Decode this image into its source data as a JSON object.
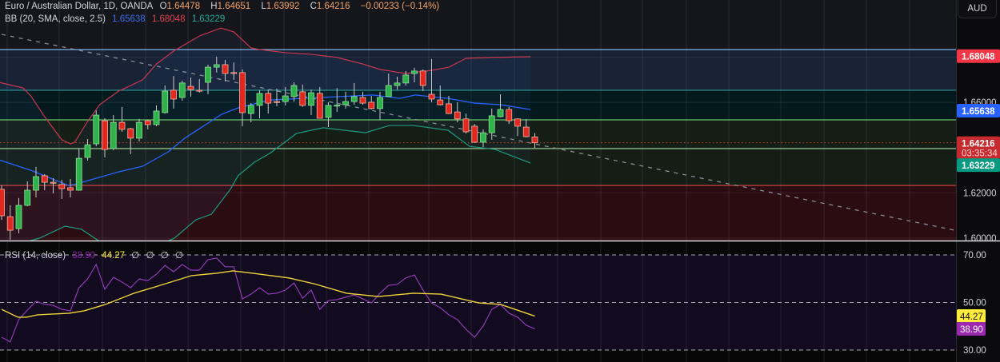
{
  "header": {
    "symbol": "Euro / Australian Dollar, 1D, OANDA",
    "o_label": "O",
    "o": "1.64478",
    "h_label": "H",
    "h": "1.64651",
    "l_label": "L",
    "l": "1.63992",
    "c_label": "C",
    "c": "1.64216",
    "change": "−0.00233 (−0.14%)"
  },
  "bb_legend": {
    "label": "BB (20, SMA, close, 2.5)",
    "basis": "1.65638",
    "upper": "1.68048",
    "lower": "1.63229"
  },
  "rsi_legend": {
    "label": "RSI (14, close)",
    "rsi": "38.90",
    "ma": "44.27",
    "extra": [
      "∅",
      "∅",
      "∅",
      "∅"
    ]
  },
  "currency_button": "AUD",
  "colors": {
    "up": "#30b24a",
    "down": "#e0281e",
    "bb_upper": "#c8374e",
    "bb_basis": "#2962ff",
    "bb_lower": "#1e9a80",
    "rsi": "#9b3fc0",
    "rsi_ma": "#f0d43a"
  },
  "chart_data": [
    {
      "type": "candlestick",
      "title": "Euro / Australian Dollar, 1D, OANDA",
      "ylim": [
        1.599,
        1.6935
      ],
      "candles": [
        [
          1.6216,
          1.6233,
          1.6081,
          1.6099
        ],
        [
          1.6095,
          1.6145,
          1.5993,
          1.6035
        ],
        [
          1.6042,
          1.6177,
          1.6021,
          1.6145
        ],
        [
          1.6145,
          1.6251,
          1.6141,
          1.6212
        ],
        [
          1.6212,
          1.6315,
          1.618,
          1.6272
        ],
        [
          1.6276,
          1.6283,
          1.6212,
          1.6247
        ],
        [
          1.6247,
          1.6265,
          1.6198,
          1.6245
        ],
        [
          1.6237,
          1.6258,
          1.6173,
          1.6219
        ],
        [
          1.6223,
          1.6262,
          1.618,
          1.6212
        ],
        [
          1.6212,
          1.6396,
          1.6209,
          1.6353
        ],
        [
          1.6357,
          1.6438,
          1.6343,
          1.6413
        ],
        [
          1.6417,
          1.6565,
          1.6406,
          1.6544
        ],
        [
          1.6519,
          1.653,
          1.6357,
          1.6392
        ],
        [
          1.6396,
          1.6544,
          1.6389,
          1.6512
        ],
        [
          1.6512,
          1.658,
          1.647,
          1.6481
        ],
        [
          1.6484,
          1.6488,
          1.6371,
          1.6442
        ],
        [
          1.6442,
          1.6527,
          1.6428,
          1.6512
        ],
        [
          1.6519,
          1.6523,
          1.6481,
          1.6502
        ],
        [
          1.6502,
          1.6587,
          1.6495,
          1.6562
        ],
        [
          1.6555,
          1.6675,
          1.6551,
          1.665
        ],
        [
          1.6654,
          1.6717,
          1.6573,
          1.6615
        ],
        [
          1.6622,
          1.6696,
          1.6608,
          1.6686
        ],
        [
          1.6671,
          1.671,
          1.6626,
          1.6657
        ],
        [
          1.6654,
          1.6703,
          1.6643,
          1.6652
        ],
        [
          1.6689,
          1.6767,
          1.6636,
          1.6756
        ],
        [
          1.6756,
          1.6802,
          1.6732,
          1.6767
        ],
        [
          1.6767,
          1.6788,
          1.6693,
          1.6728
        ],
        [
          1.6732,
          1.6777,
          1.67,
          1.6731
        ],
        [
          1.6732,
          1.6746,
          1.6495,
          1.6555
        ],
        [
          1.6551,
          1.6597,
          1.6512,
          1.6587
        ],
        [
          1.6587,
          1.6654,
          1.653,
          1.664
        ],
        [
          1.664,
          1.6657,
          1.6551,
          1.6597
        ],
        [
          1.6604,
          1.6661,
          1.6583,
          1.6603
        ],
        [
          1.6604,
          1.6668,
          1.6587,
          1.6629
        ],
        [
          1.6626,
          1.6689,
          1.6604,
          1.6675
        ],
        [
          1.6647,
          1.6679,
          1.658,
          1.6587
        ],
        [
          1.6587,
          1.6657,
          1.6544,
          1.6643
        ],
        [
          1.664,
          1.6668,
          1.653,
          1.653
        ],
        [
          1.6534,
          1.6601,
          1.6491,
          1.6587
        ],
        [
          1.6587,
          1.6664,
          1.6558,
          1.6588
        ],
        [
          1.659,
          1.6647,
          1.6573,
          1.6604
        ],
        [
          1.6604,
          1.6686,
          1.659,
          1.6626
        ],
        [
          1.6622,
          1.6647,
          1.659,
          1.6597
        ],
        [
          1.6601,
          1.6629,
          1.6569,
          1.6573
        ],
        [
          1.6573,
          1.6647,
          1.6523,
          1.6622
        ],
        [
          1.6626,
          1.6728,
          1.6626,
          1.6675
        ],
        [
          1.6675,
          1.6714,
          1.6657,
          1.6686
        ],
        [
          1.6686,
          1.6739,
          1.6675,
          1.6721
        ],
        [
          1.6728,
          1.6753,
          1.6689,
          1.6739
        ],
        [
          1.6739,
          1.6746,
          1.665,
          1.6675
        ],
        [
          1.6636,
          1.6792,
          1.6601,
          1.6615
        ],
        [
          1.6611,
          1.6675,
          1.6587,
          1.659
        ],
        [
          1.6594,
          1.6629,
          1.6548,
          1.6551
        ],
        [
          1.6558,
          1.6601,
          1.6512,
          1.6527
        ],
        [
          1.6527,
          1.6551,
          1.6463,
          1.647
        ],
        [
          1.6495,
          1.6505,
          1.6421,
          1.6424
        ],
        [
          1.6424,
          1.6481,
          1.6403,
          1.6466
        ],
        [
          1.6466,
          1.6573,
          1.6435,
          1.6541
        ],
        [
          1.6537,
          1.6636,
          1.6534,
          1.6569
        ],
        [
          1.6569,
          1.658,
          1.6505,
          1.6519
        ],
        [
          1.6527,
          1.653,
          1.6452,
          1.6495
        ],
        [
          1.6491,
          1.6527,
          1.6445,
          1.6449
        ],
        [
          1.64478,
          1.64651,
          1.63992,
          1.64216
        ]
      ],
      "bb_upper": [
        [
          0.7,
          1.6689
        ],
        [
          3.5,
          1.6664
        ],
        [
          4.4,
          1.6629
        ],
        [
          6,
          1.6537
        ],
        [
          8,
          1.6435
        ],
        [
          9,
          1.6417
        ],
        [
          9.5,
          1.6424
        ],
        [
          11,
          1.6516
        ],
        [
          12.4,
          1.659
        ],
        [
          14.6,
          1.665
        ],
        [
          17.4,
          1.67
        ],
        [
          19,
          1.677
        ],
        [
          21,
          1.6827
        ],
        [
          24,
          1.6894
        ],
        [
          26.5,
          1.6929
        ],
        [
          28,
          1.6912
        ],
        [
          30,
          1.6841
        ],
        [
          31,
          1.6834
        ],
        [
          34,
          1.682
        ],
        [
          37,
          1.6813
        ],
        [
          40,
          1.6799
        ],
        [
          43,
          1.677
        ],
        [
          45,
          1.6746
        ],
        [
          48,
          1.6728
        ],
        [
          51,
          1.6742
        ],
        [
          53,
          1.6756
        ],
        [
          55,
          1.6795
        ],
        [
          58,
          1.6799
        ],
        [
          62.5,
          1.6802
        ]
      ],
      "bb_basis": [
        [
          0.7,
          1.6346
        ],
        [
          4.4,
          1.63
        ],
        [
          8.8,
          1.6233
        ],
        [
          9.7,
          1.624
        ],
        [
          14.6,
          1.6293
        ],
        [
          17.4,
          1.6318
        ],
        [
          20.4,
          1.6382
        ],
        [
          22.3,
          1.6442
        ],
        [
          26.6,
          1.6548
        ],
        [
          28.5,
          1.6576
        ],
        [
          32.2,
          1.6611
        ],
        [
          44.2,
          1.6633
        ],
        [
          47.3,
          1.6618
        ],
        [
          49.1,
          1.6633
        ],
        [
          52.9,
          1.6618
        ],
        [
          56,
          1.6597
        ],
        [
          59,
          1.659
        ],
        [
          62.5,
          1.6569
        ]
      ],
      "bb_lower": [
        [
          0.7,
          1.595
        ],
        [
          5.4,
          1.6
        ],
        [
          8.4,
          1.6053
        ],
        [
          10.3,
          1.6039
        ],
        [
          11.8,
          1.6
        ],
        [
          14,
          1.595
        ],
        [
          18,
          1.595
        ],
        [
          21.1,
          1.6
        ],
        [
          23.6,
          1.6081
        ],
        [
          25.4,
          1.6106
        ],
        [
          27.6,
          1.6216
        ],
        [
          28.5,
          1.6276
        ],
        [
          30.4,
          1.6336
        ],
        [
          32.2,
          1.6375
        ],
        [
          35.3,
          1.6463
        ],
        [
          38.4,
          1.6488
        ],
        [
          43.3,
          1.6466
        ],
        [
          46.1,
          1.6498
        ],
        [
          48.9,
          1.6498
        ],
        [
          52.9,
          1.6477
        ],
        [
          55.4,
          1.6406
        ],
        [
          58.4,
          1.6392
        ],
        [
          62.5,
          1.6332
        ]
      ],
      "levels": [
        {
          "value": 1.6834,
          "color": "#7fb2e0"
        },
        {
          "value": 1.6654,
          "color": "#2a9c94"
        },
        {
          "value": 1.6523,
          "color": "#6cbf6c"
        },
        {
          "value": 1.6396,
          "color": "#9fd49a"
        },
        {
          "value": 1.6233,
          "color": "#d9454e"
        }
      ],
      "zones": [
        {
          "from": 1.6834,
          "to": 1.6654,
          "color": "#172335"
        },
        {
          "from": 1.6654,
          "to": 1.6523,
          "color": "#04191c"
        },
        {
          "from": 1.6523,
          "to": 1.6233,
          "color": "#141e15"
        },
        {
          "from": 1.6233,
          "to": 1.59,
          "color": "#2a0c11"
        }
      ],
      "trendline": [
        [
          1,
          1.6901
        ],
        [
          116.3,
          1.6
        ]
      ],
      "current_price": 1.64216,
      "price_axis": {
        "ticks": [
          {
            "value": 1.66,
            "text": "1.66000"
          },
          {
            "value": 1.62,
            "text": "1.62000"
          },
          {
            "value": 1.6,
            "text": "1.60000"
          }
        ],
        "badges": [
          {
            "value": 1.68048,
            "text": "1.68048",
            "color": "#f23645"
          },
          {
            "value": 1.65638,
            "text": "1.65638",
            "color": "#2962ff"
          },
          {
            "value": 1.64216,
            "text": "1.64216",
            "color": "#c62a2f"
          },
          {
            "value": 1.63229,
            "text": "1.63229",
            "color": "#089981"
          }
        ],
        "countdown": "03:35:34"
      }
    },
    {
      "type": "line",
      "title": "RSI (14, close)",
      "ylim": [
        25,
        75
      ],
      "bands": [
        70,
        50,
        30
      ],
      "rsi": [
        35.4,
        33.4,
        42.8,
        46.8,
        50.5,
        49.2,
        48.8,
        47.1,
        46.5,
        56.2,
        59.9,
        66.0,
        55.5,
        60.6,
        58.6,
        56.2,
        59.9,
        59.2,
        61.9,
        65.6,
        62.9,
        66.0,
        63.6,
        63.6,
        68.0,
        68.7,
        65.0,
        65.0,
        51.5,
        53.5,
        56.2,
        53.5,
        53.9,
        55.2,
        58.2,
        51.8,
        55.2,
        47.1,
        50.8,
        51.2,
        52.2,
        53.2,
        51.5,
        49.8,
        53.9,
        57.2,
        57.6,
        60.3,
        61.6,
        55.2,
        49.8,
        47.8,
        44.8,
        42.8,
        38.7,
        35.4,
        40.1,
        47.1,
        49.2,
        45.5,
        43.8,
        40.4,
        38.9
      ],
      "rsi_ma": [
        [
          1,
          47.1
        ],
        [
          2.9,
          43.8
        ],
        [
          3.9,
          43.8
        ],
        [
          5.2,
          44.8
        ],
        [
          8.9,
          45.5
        ],
        [
          10.6,
          46.5
        ],
        [
          13.1,
          49.2
        ],
        [
          16.4,
          53.9
        ],
        [
          18.9,
          56.6
        ],
        [
          23.1,
          61.3
        ],
        [
          26,
          62.3
        ],
        [
          27.9,
          63.3
        ],
        [
          30.2,
          62.3
        ],
        [
          34.4,
          60.3
        ],
        [
          37.3,
          57.9
        ],
        [
          41.1,
          53.9
        ],
        [
          44.8,
          52.5
        ],
        [
          48.9,
          53.9
        ],
        [
          52.1,
          53.5
        ],
        [
          56.5,
          49.8
        ],
        [
          59,
          49.2
        ],
        [
          63,
          44.27
        ]
      ],
      "axis": {
        "ticks": [
          {
            "value": 70,
            "text": "70.00"
          },
          {
            "value": 50,
            "text": "50.00"
          },
          {
            "value": 30,
            "text": "30.00"
          }
        ],
        "badges": [
          {
            "value": 44.27,
            "text": "44.27",
            "color": "#ffeb3b",
            "textColor": "#111111"
          },
          {
            "value": 38.9,
            "text": "38.90",
            "color": "#9c27b0",
            "textColor": "#ffffff"
          }
        ]
      }
    }
  ]
}
